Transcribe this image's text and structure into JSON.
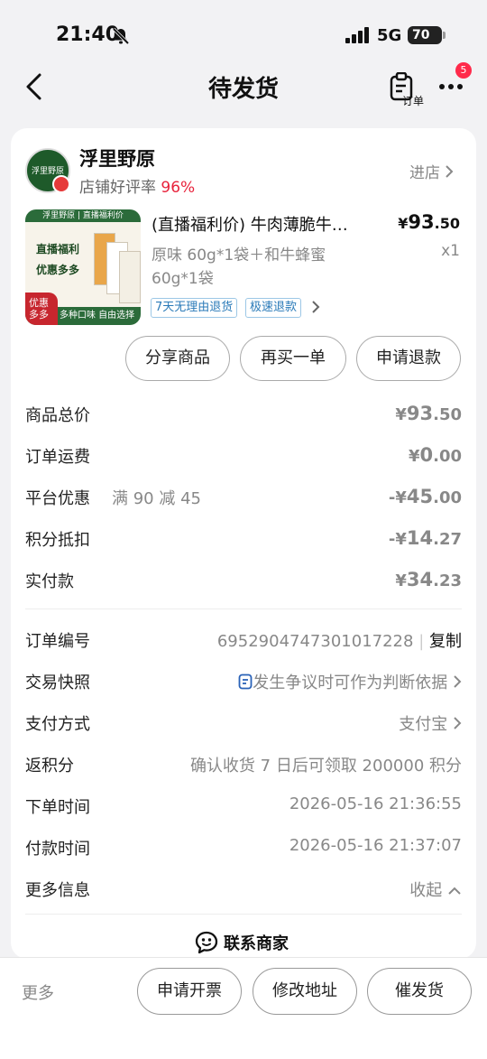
{
  "status_bar": {
    "time": "21:40",
    "network": "5G",
    "battery": "70"
  },
  "nav": {
    "title": "待发货",
    "order_label": "订单",
    "badge_count": "5"
  },
  "shop": {
    "logo_text": "浮里野原",
    "name": "浮里野原",
    "rating_label": "店铺好评率",
    "rating_value": "96%",
    "enter_label": "进店"
  },
  "product": {
    "thumb_top_text": "浮里野原 | 直播福利价",
    "thumb_line1": "直播福利",
    "thumb_line2": "优惠多多",
    "thumb_badge": "优惠多多",
    "thumb_footer": "多种口味  自由选择",
    "title": "(直播福利价) 牛肉薄脆牛…",
    "price_symbol": "¥",
    "price_int": "93",
    "price_dec": ".50",
    "sku_line1": "原味 60g*1袋＋和牛蜂蜜",
    "sku_line2": "60g*1袋",
    "quantity": "x1",
    "tags": [
      "7天无理由退货",
      "极速退款"
    ]
  },
  "actions": {
    "share": "分享商品",
    "rebuy": "再买一单",
    "refund": "申请退款"
  },
  "costs": {
    "total_label": "商品总价",
    "total_sym": "¥",
    "total_int": "93",
    "total_dec": ".50",
    "shipping_label": "订单运费",
    "shipping_sym": "¥",
    "shipping_int": "0",
    "shipping_dec": ".00",
    "discount_label": "平台优惠",
    "discount_desc": "满 90 减 45",
    "discount_sym": "-¥",
    "discount_int": "45",
    "discount_dec": ".00",
    "points_label": "积分抵扣",
    "points_sym": "-¥",
    "points_int": "14",
    "points_dec": ".27",
    "paid_label": "实付款",
    "paid_sym": "¥",
    "paid_int": "34",
    "paid_dec": ".23"
  },
  "info": {
    "order_no_label": "订单编号",
    "order_no": "6952904747301017228",
    "copy_label": "复制",
    "snapshot_label": "交易快照",
    "snapshot_value": "发生争议时可作为判断依据",
    "payment_label": "支付方式",
    "payment_value": "支付宝",
    "rebate_label": "返积分",
    "rebate_value": "确认收货 7 日后可领取 200000 积分",
    "order_time_label": "下单时间",
    "order_time": "2026-05-16 21:36:55",
    "pay_time_label": "付款时间",
    "pay_time": "2026-05-16 21:37:07",
    "more_info_label": "更多信息",
    "collapse_label": "收起"
  },
  "contact": {
    "label": "联系商家"
  },
  "bottom": {
    "more": "更多",
    "invoice": "申请开票",
    "address": "修改地址",
    "urge": "催发货"
  },
  "colors": {
    "accent_red": "#e8233c",
    "link_blue": "#2a62b8",
    "badge_red": "#ff2a4a"
  }
}
